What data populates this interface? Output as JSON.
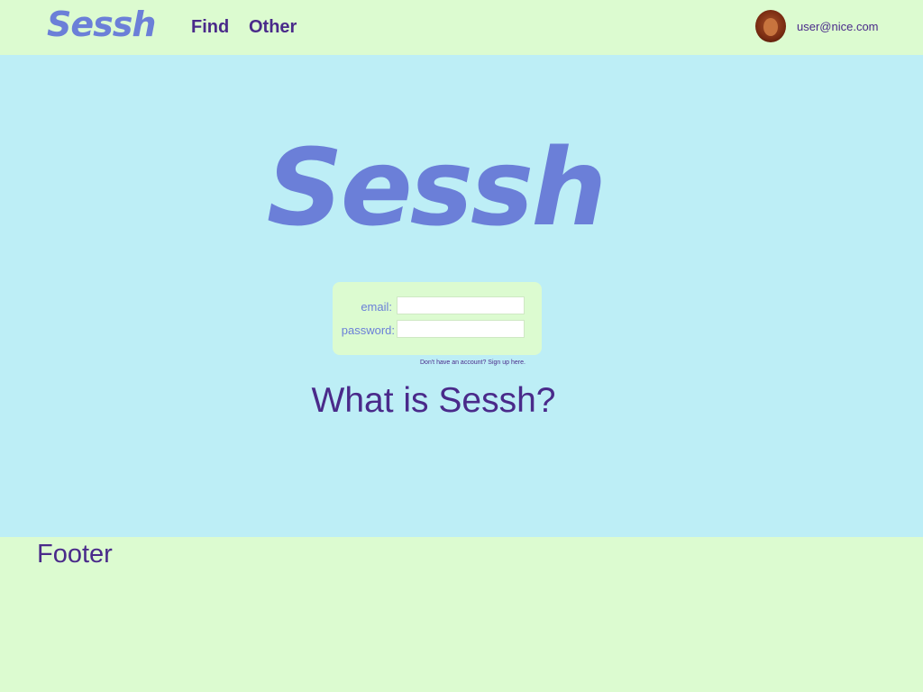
{
  "header": {
    "logo_text": "Sessh",
    "nav": [
      {
        "label": "Find"
      },
      {
        "label": "Other"
      }
    ],
    "avatar_icon": "user-avatar-photo",
    "user_email": "user@nice.com"
  },
  "main": {
    "logo_text": "Sessh",
    "login": {
      "email_label": "email:",
      "email_value": "",
      "password_label": "password:",
      "password_value": ""
    },
    "signup_text": "Don't have an account? Sign up here.",
    "heading": "What is Sessh?"
  },
  "footer": {
    "title": "Footer"
  },
  "colors": {
    "header_bg": "#dcfbd0",
    "main_bg": "#bdeef6",
    "logo": "#6b7fd8",
    "text": "#4a2a8a"
  }
}
